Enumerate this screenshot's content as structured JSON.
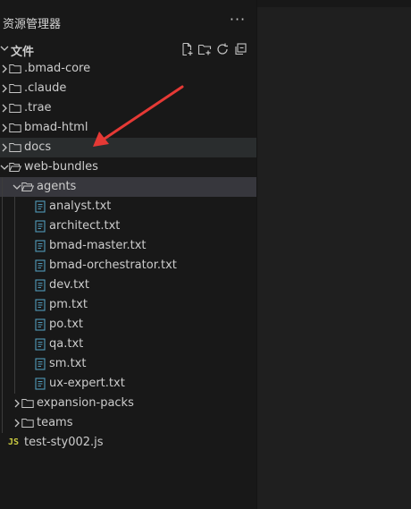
{
  "panel": {
    "title": "资源管理器",
    "more": "···"
  },
  "section": {
    "title": "文件",
    "actions": [
      "new-file-icon",
      "new-folder-icon",
      "refresh-icon",
      "collapse-all-icon"
    ]
  },
  "colors": {
    "folder_icon": "#c5c5c5",
    "file_icon": "#519aba",
    "js_icon": "#cbcb41",
    "arrow": "#e53935",
    "selected_row": "#37373d"
  },
  "tree": [
    {
      "label": ".bmad-core",
      "type": "folder",
      "depth": 0,
      "expanded": false
    },
    {
      "label": ".claude",
      "type": "folder",
      "depth": 0,
      "expanded": false
    },
    {
      "label": ".trae",
      "type": "folder",
      "depth": 0,
      "expanded": false
    },
    {
      "label": "bmad-html",
      "type": "folder",
      "depth": 0,
      "expanded": false
    },
    {
      "label": "docs",
      "type": "folder",
      "depth": 0,
      "expanded": false,
      "state": "hover"
    },
    {
      "label": "web-bundles",
      "type": "folder",
      "depth": 0,
      "expanded": true
    },
    {
      "label": "agents",
      "type": "folder",
      "depth": 1,
      "expanded": true,
      "state": "selected"
    },
    {
      "label": "analyst.txt",
      "type": "txt",
      "depth": 2
    },
    {
      "label": "architect.txt",
      "type": "txt",
      "depth": 2
    },
    {
      "label": "bmad-master.txt",
      "type": "txt",
      "depth": 2
    },
    {
      "label": "bmad-orchestrator.txt",
      "type": "txt",
      "depth": 2
    },
    {
      "label": "dev.txt",
      "type": "txt",
      "depth": 2
    },
    {
      "label": "pm.txt",
      "type": "txt",
      "depth": 2
    },
    {
      "label": "po.txt",
      "type": "txt",
      "depth": 2
    },
    {
      "label": "qa.txt",
      "type": "txt",
      "depth": 2
    },
    {
      "label": "sm.txt",
      "type": "txt",
      "depth": 2
    },
    {
      "label": "ux-expert.txt",
      "type": "txt",
      "depth": 2
    },
    {
      "label": "expansion-packs",
      "type": "folder",
      "depth": 1,
      "expanded": false
    },
    {
      "label": "teams",
      "type": "folder",
      "depth": 1,
      "expanded": false
    },
    {
      "label": "test-sty002.js",
      "type": "js",
      "depth": 0,
      "icon_text": "JS"
    }
  ]
}
